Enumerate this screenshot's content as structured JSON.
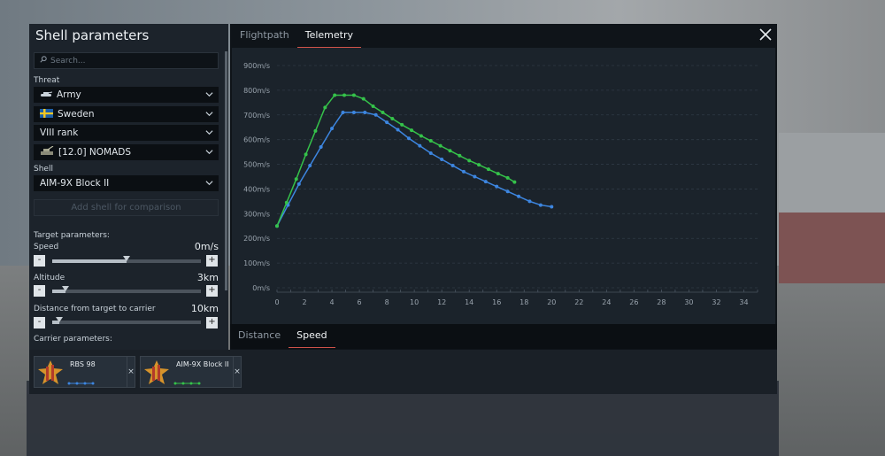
{
  "panel": {
    "title": "Shell parameters",
    "search_placeholder": "Search...",
    "threat_label": "Threat",
    "threat_value": "Army",
    "country_value": "Sweden",
    "rank_value": "VIII rank",
    "vehicle_value": "[12.0] NOMADS",
    "shell_label": "Shell",
    "shell_value": "AIM-9X Block II",
    "add_shell_label": "Add shell for comparison",
    "target_params_label": "Target parameters:",
    "speed": {
      "label": "Speed",
      "value": "0m/s",
      "level": 0.5
    },
    "altitude": {
      "label": "Altitude",
      "value": "3km",
      "level": 0.09
    },
    "distance": {
      "label": "Distance from target to carrier",
      "value": "10km",
      "level": 0.05
    },
    "carrier_params_label": "Carrier parameters:",
    "minus": "-",
    "plus": "+"
  },
  "tabs_top": [
    "Flightpath",
    "Telemetry"
  ],
  "tabs_top_active": 1,
  "tabs_bottom": [
    "Distance",
    "Speed"
  ],
  "tabs_bottom_active": 1,
  "close_icon": "close-icon",
  "cards": [
    {
      "name": "RBS 98",
      "color": "#3d86e0",
      "x": "×"
    },
    {
      "name": "AIM-9X Block II",
      "color": "#35c24a",
      "x": "×"
    }
  ],
  "colors": {
    "blue": "#3d86e0",
    "green": "#35c24a",
    "accent": "#d0524a"
  },
  "chart_data": {
    "type": "line",
    "x_ticks": [
      0,
      2,
      4,
      6,
      8,
      10,
      12,
      14,
      16,
      18,
      20,
      22,
      24,
      26,
      28,
      30,
      32,
      34
    ],
    "y_ticks": [
      "0m/s",
      "100m/s",
      "200m/s",
      "300m/s",
      "400m/s",
      "500m/s",
      "600m/s",
      "700m/s",
      "800m/s",
      "900m/s"
    ],
    "xlim": [
      0,
      35
    ],
    "ylim": [
      0,
      900
    ],
    "grid": true,
    "series": [
      {
        "color": "#3d86e0",
        "x": [
          0,
          0.8,
          1.6,
          2.4,
          3.2,
          4.0,
          4.8,
          5.6,
          6.4,
          7.2,
          8.0,
          8.8,
          9.6,
          10.4,
          11.2,
          12.0,
          12.8,
          13.6,
          14.4,
          15.2,
          16.0,
          16.8,
          17.6,
          18.4,
          19.2,
          20.0
        ],
        "y": [
          250,
          335,
          420,
          495,
          570,
          645,
          710,
          710,
          710,
          700,
          670,
          640,
          605,
          575,
          545,
          520,
          495,
          470,
          450,
          430,
          410,
          390,
          370,
          350,
          335,
          328
        ]
      },
      {
        "color": "#35c24a",
        "x": [
          0,
          0.7,
          1.4,
          2.1,
          2.8,
          3.5,
          4.2,
          4.9,
          5.6,
          6.3,
          7.0,
          7.7,
          8.4,
          9.1,
          9.8,
          10.5,
          11.2,
          11.9,
          12.6,
          13.3,
          14.0,
          14.7,
          15.4,
          16.1,
          16.8,
          17.3
        ],
        "y": [
          250,
          345,
          440,
          540,
          635,
          730,
          780,
          780,
          780,
          765,
          735,
          710,
          685,
          660,
          638,
          615,
          595,
          575,
          555,
          535,
          515,
          498,
          480,
          462,
          445,
          428
        ]
      }
    ]
  }
}
